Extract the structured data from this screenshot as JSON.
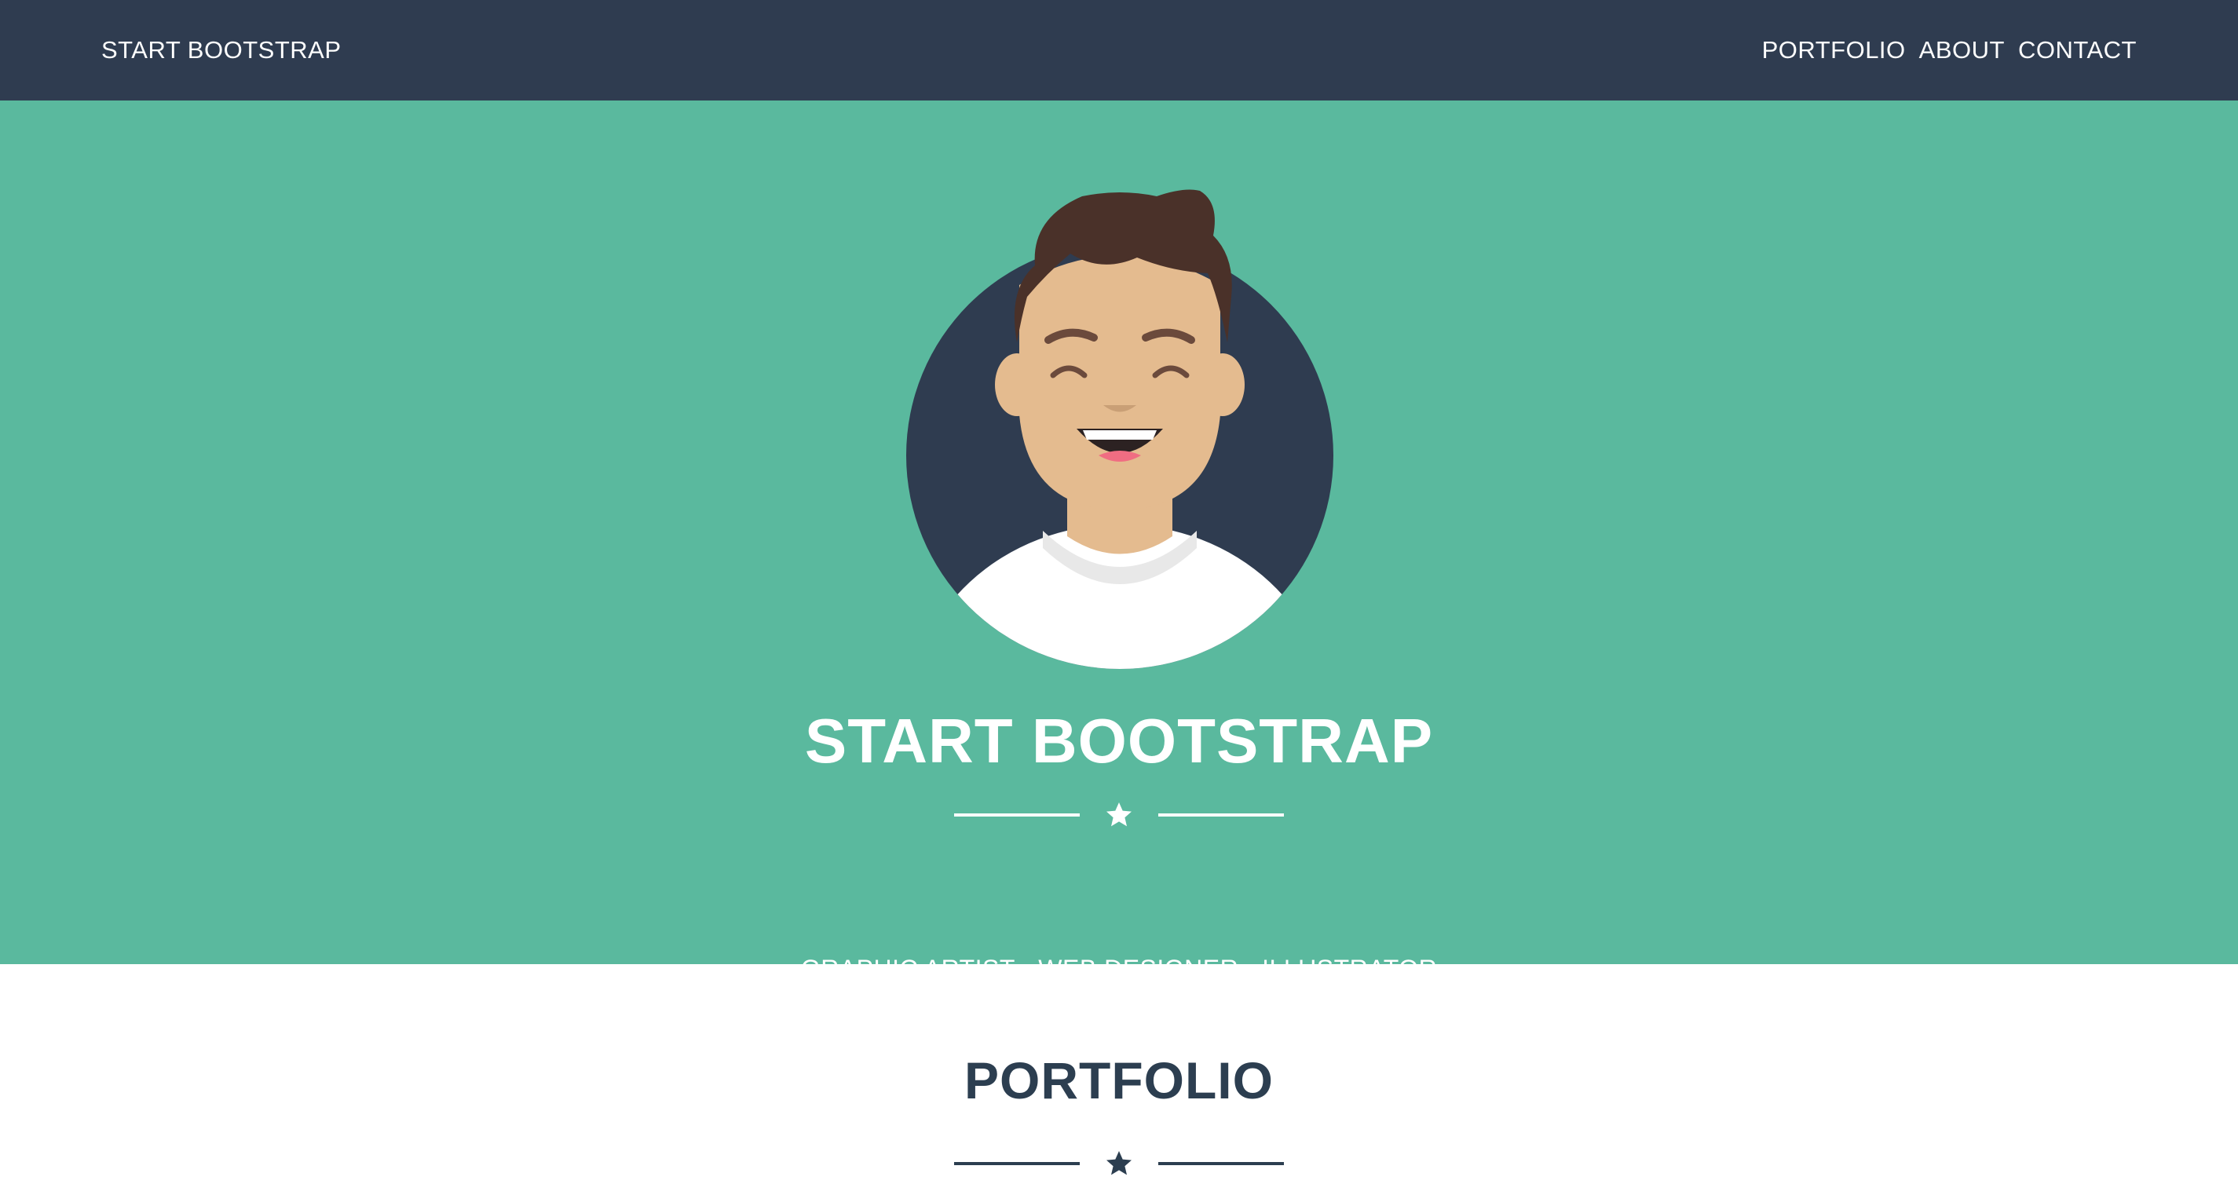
{
  "navbar": {
    "brand": "START BOOTSTRAP",
    "links": [
      "PORTFOLIO",
      "ABOUT",
      "CONTACT"
    ]
  },
  "masthead": {
    "heading": "START BOOTSTRAP",
    "subheading": "GRAPHIC ARTIST - WEB DESIGNER - ILLUSTRATOR",
    "divider_icon": "star-icon"
  },
  "portfolio": {
    "heading": "PORTFOLIO",
    "divider_icon": "star-icon"
  },
  "colors": {
    "navbar_bg": "#2f3c50",
    "masthead_bg": "#5ab99e",
    "avatar_bg": "#2f3c50",
    "text_light": "#ffffff",
    "text_dark": "#2c3e50"
  }
}
